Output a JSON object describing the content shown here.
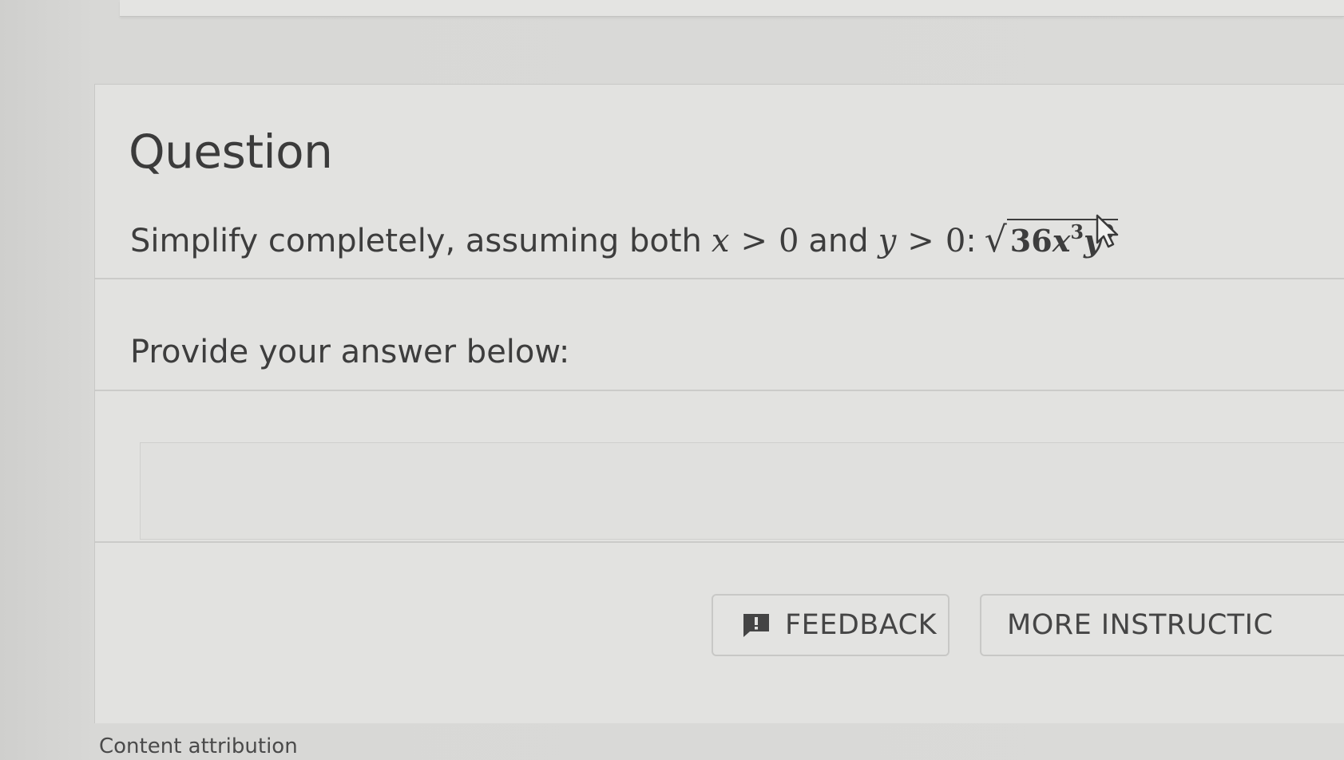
{
  "question": {
    "title": "Question",
    "prompt_prefix": "Simplify completely, assuming both",
    "var_x": "x",
    "gt": ">",
    "zero": "0",
    "and_word": "and",
    "var_y": "y",
    "colon": ":",
    "radicand": {
      "coefficient": "36",
      "base1": "x",
      "exp1": "3",
      "base2": "y",
      "exp2": "9"
    }
  },
  "answer": {
    "prompt": "Provide your answer below:",
    "value": ""
  },
  "buttons": {
    "feedback_label": "FEEDBACK",
    "more_instructions_label": "MORE INSTRUCTIC"
  },
  "footer": {
    "attribution": "Content attribution"
  },
  "icons": {
    "feedback": "feedback-icon",
    "cursor": "cursor-icon"
  },
  "colors": {
    "background": "#d9d9d7",
    "card": "#e2e2e0",
    "text": "#3d3d3d"
  }
}
